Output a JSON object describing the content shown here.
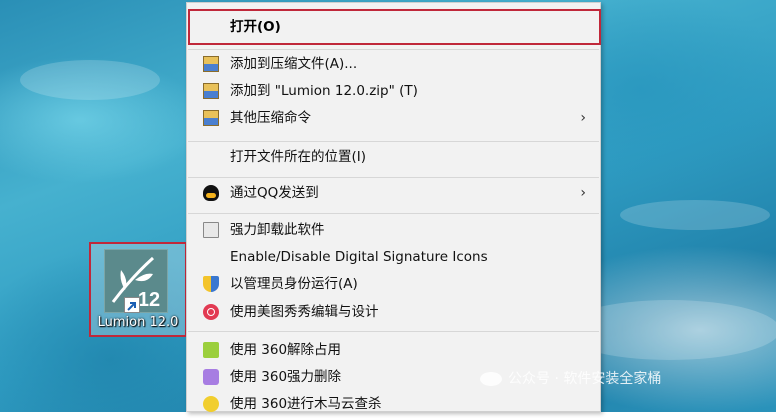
{
  "desktop": {
    "shortcut": {
      "label": "Lumion 12.0",
      "badge": "12",
      "icon": "lumion-icon"
    }
  },
  "context_menu": {
    "items": [
      {
        "label": "打开(O)",
        "icon": null,
        "highlighted": true
      },
      {
        "label": "添加到压缩文件(A)...",
        "icon": "archive-icon"
      },
      {
        "label": "添加到 \"Lumion 12.0.zip\" (T)",
        "icon": "archive-icon"
      },
      {
        "label": "其他压缩命令",
        "icon": "archive-icon",
        "submenu": true
      },
      {
        "label": "打开文件所在的位置(I)",
        "icon": null
      },
      {
        "label": "通过QQ发送到",
        "icon": "qq-icon",
        "submenu": true
      },
      {
        "label": "强力卸载此软件",
        "icon": "trash-icon"
      },
      {
        "label": "Enable/Disable Digital Signature Icons",
        "icon": null
      },
      {
        "label": "以管理员身份运行(A)",
        "icon": "shield-icon"
      },
      {
        "label": "使用美图秀秀编辑与设计",
        "icon": "meitu-icon"
      },
      {
        "label": "使用 360解除占用",
        "icon": "360-unlock-icon"
      },
      {
        "label": "使用 360强力删除",
        "icon": "360-delete-icon"
      },
      {
        "label": "使用 360进行木马云查杀",
        "icon": "360-scan-icon"
      }
    ],
    "submenu_arrow": "›"
  },
  "watermark": {
    "text": "公众号 · 软件安装全家桶"
  },
  "colors": {
    "highlight_border": "#c0283a",
    "menu_background": "#f2f2f2"
  }
}
